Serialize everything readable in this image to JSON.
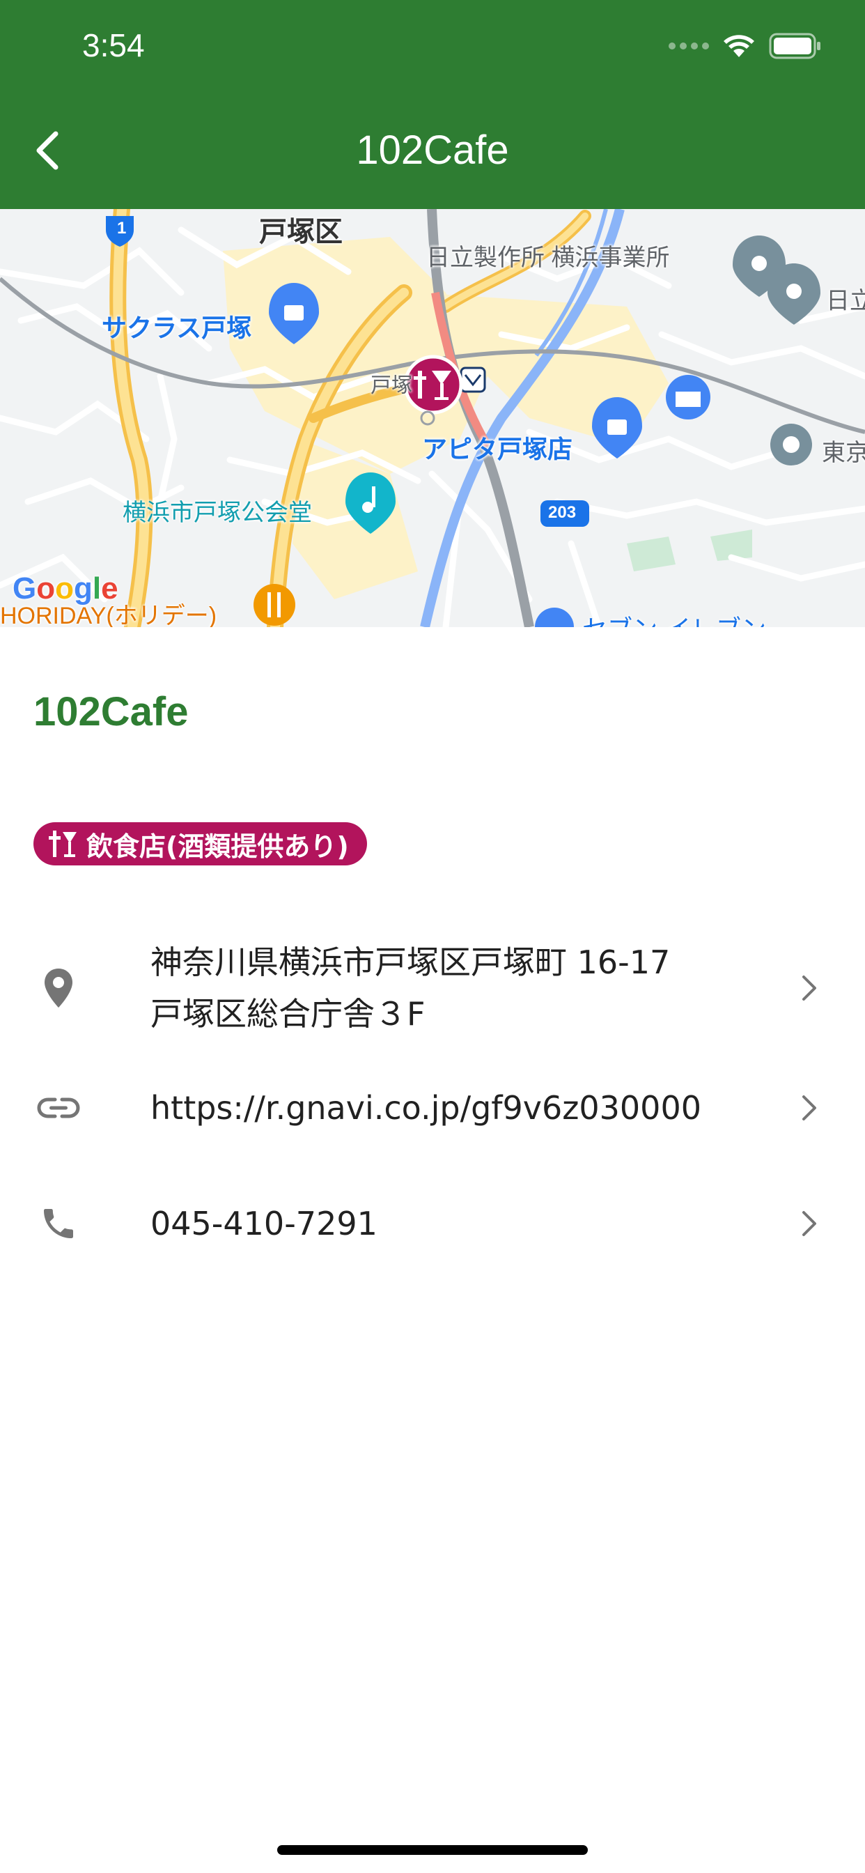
{
  "status_bar": {
    "time": "3:54"
  },
  "nav": {
    "title": "102Cafe",
    "back_icon": "chevron-left-icon"
  },
  "map": {
    "labels": {
      "ward": "戸塚区",
      "hitachi": "日立製作所 横浜事業所",
      "hitachi_short": "日立",
      "sakuras": "サクラス戸塚",
      "station": "戸塚",
      "apita": "アピタ戸塚店",
      "tokyo": "東京",
      "hall": "横浜市戸塚公会堂",
      "holiday": "HORIDAY(ホリデー)",
      "seven": "セブン-イレブン",
      "route_1": "1",
      "route_203": "203",
      "google": "Google"
    },
    "colors": {
      "background": "#f1f3f4",
      "major_road": "#fbc04c",
      "minor_road": "#ffffff",
      "rail": "#9aa0a6",
      "river": "#8ab4f8",
      "commercial": "#fdf2c8",
      "selected_marker": "#b2145c"
    }
  },
  "place": {
    "name": "102Cafe",
    "category": "飲食店(酒類提供あり)",
    "category_icon": "food-drink-icon",
    "category_color": "#b2145c"
  },
  "details": {
    "address_line1": "神奈川県横浜市戸塚区戸塚町 16-17",
    "address_line2": "戸塚区総合庁舎３F",
    "url": "https://r.gnavi.co.jp/gf9v6z030000",
    "phone": "045-410-7291"
  },
  "theme": {
    "primary": "#2e7d32",
    "icon_gray": "#757575"
  }
}
